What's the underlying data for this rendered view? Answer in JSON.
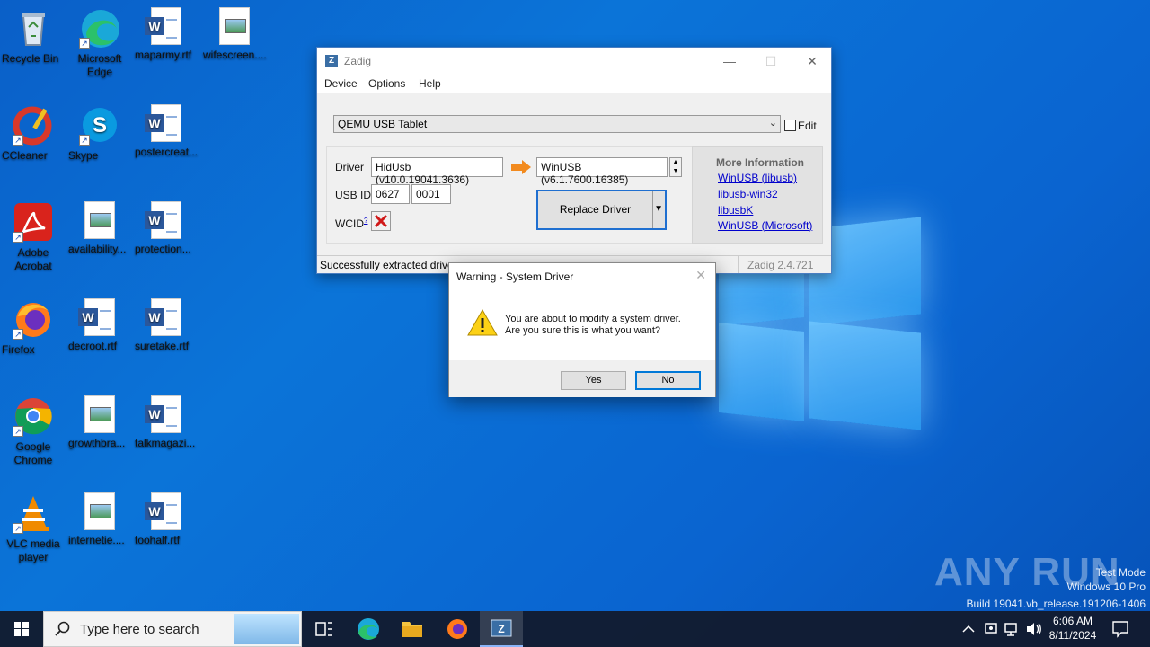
{
  "desktop": {
    "icons": [
      {
        "label": "Recycle Bin"
      },
      {
        "label": "Microsoft Edge"
      },
      {
        "label": "maparmy.rtf"
      },
      {
        "label": "wifescreen...."
      },
      {
        "label": "CCleaner"
      },
      {
        "label": "Skype"
      },
      {
        "label": "postercreat..."
      },
      {
        "label": "Adobe Acrobat"
      },
      {
        "label": "availability..."
      },
      {
        "label": "protection..."
      },
      {
        "label": "Firefox"
      },
      {
        "label": "decroot.rtf"
      },
      {
        "label": "suretake.rtf"
      },
      {
        "label": "Google Chrome"
      },
      {
        "label": "growthbra..."
      },
      {
        "label": "talkmagazi..."
      },
      {
        "label": "VLC media player"
      },
      {
        "label": "internetie...."
      },
      {
        "label": "toohalf.rtf"
      }
    ]
  },
  "zadig": {
    "title": "Zadig",
    "app_icon_text": "Z",
    "menu": [
      "Device",
      "Options",
      "Help"
    ],
    "device_selected": "QEMU USB Tablet",
    "edit_label": "Edit",
    "driver_label": "Driver",
    "current_driver": "HidUsb (v10.0.19041.3636)",
    "target_driver": "WinUSB (v6.1.7600.16385)",
    "usbid_label": "USB ID",
    "usb_vid": "0627",
    "usb_pid": "0001",
    "wcid_label": "WCID",
    "wcid_sup": "?",
    "replace_button": "Replace Driver",
    "more_info_title": "More Information",
    "links": [
      "WinUSB (libusb)",
      "libusb-win32",
      "libusbK",
      "WinUSB (Microsoft)"
    ],
    "status": "Successfully extracted drive",
    "status_tail": "s",
    "version": "Zadig 2.4.721"
  },
  "dialog": {
    "title": "Warning - System Driver",
    "line1": "You are about to modify a system driver.",
    "line2": "Are you sure this is what you want?",
    "yes": "Yes",
    "no": "No"
  },
  "watermark": {
    "brand": "ANY RUN",
    "line1": "Test Mode",
    "line2": "Windows 10 Pro",
    "line3": "Build 19041.vb_release.191206-1406"
  },
  "taskbar": {
    "search_placeholder": "Type here to search",
    "time": "6:06 AM",
    "date": "8/11/2024"
  }
}
